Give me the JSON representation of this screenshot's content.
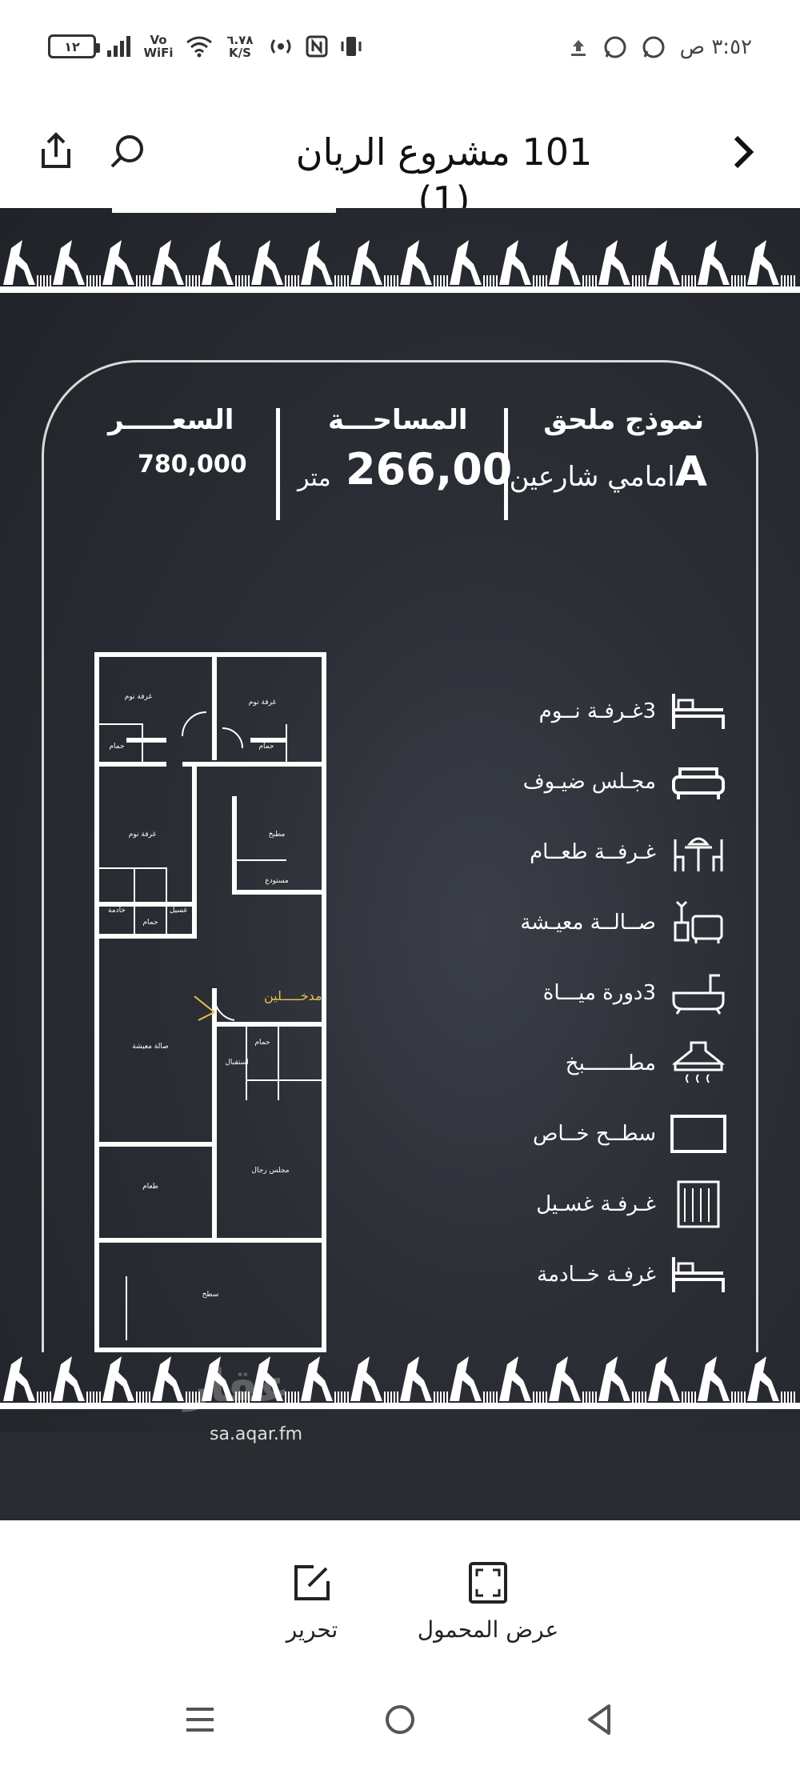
{
  "status_bar": {
    "battery": "١٢",
    "network": "Vo WiFi",
    "speed": "٦.٧٨ K/S",
    "time": "٣:٥٢ ص"
  },
  "header": {
    "title": "101 مشروع الريان (1)"
  },
  "listing_image": {
    "model_title": "نموذج ملحق",
    "model_letter": "A",
    "model_sub": "امامي شارعين",
    "area_label": "المساحـــة",
    "area_value": "266,00",
    "area_unit": "متر",
    "price_label": "السعـــــر",
    "price_value": "780,000",
    "entrance_label": "مدخـــــلين",
    "features": [
      {
        "label": "3غـرفـة نــوم",
        "icon": "bed-icon"
      },
      {
        "label": "مجـلس ضيـوف",
        "icon": "sofa-icon"
      },
      {
        "label": "غـرفــة طعــام",
        "icon": "dining-icon"
      },
      {
        "label": "صــالــة معيـشة",
        "icon": "living-room-icon"
      },
      {
        "label": "3دورة ميـــاة",
        "icon": "bathtub-icon"
      },
      {
        "label": "مطـــــــبخ",
        "icon": "kitchen-hood-icon"
      },
      {
        "label": "سطــح خــاص",
        "icon": "roof-icon"
      },
      {
        "label": "غـرفـة غسـيل",
        "icon": "laundry-icon"
      },
      {
        "label": "غرفـة خــادمة",
        "icon": "maid-bed-icon"
      }
    ],
    "rooms": [
      {
        "label": "غرفة نوم"
      },
      {
        "label": "غرفة نوم"
      },
      {
        "label": "حمام"
      },
      {
        "label": "حمام"
      },
      {
        "label": "غرفة نوم"
      },
      {
        "label": "مطبخ"
      },
      {
        "label": "مستودع"
      },
      {
        "label": "خادمة"
      },
      {
        "label": "غسيل"
      },
      {
        "label": "حمام"
      },
      {
        "label": "صالة معيشة"
      },
      {
        "label": "استقبال"
      },
      {
        "label": "حمام"
      },
      {
        "label": "طعام"
      },
      {
        "label": "مجلس رجال"
      },
      {
        "label": "سطح"
      }
    ],
    "watermark_logo": "عقار",
    "watermark_url": "sa.aqar.fm"
  },
  "actions": {
    "edit_label": "تحرير",
    "mobile_view_label": "عرض المحمول"
  }
}
